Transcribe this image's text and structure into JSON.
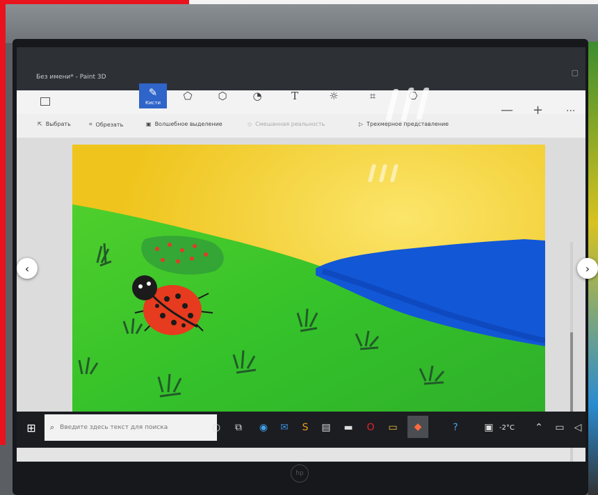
{
  "app": {
    "window_title": "Без имени* - Paint 3D"
  },
  "toolbar": {
    "tools": [
      {
        "name": "brushes",
        "label": "Кисти",
        "icon": "brush-icon",
        "active": true
      },
      {
        "name": "2d-shapes",
        "label": "",
        "icon": "shapes-2d-icon"
      },
      {
        "name": "3d-shapes",
        "label": "",
        "icon": "shapes-3d-icon"
      },
      {
        "name": "stickers",
        "label": "",
        "icon": "sticker-icon"
      },
      {
        "name": "text",
        "label": "",
        "icon": "text-icon"
      },
      {
        "name": "effects",
        "label": "",
        "icon": "effects-icon"
      },
      {
        "name": "canvas",
        "label": "",
        "icon": "crop-icon"
      },
      {
        "name": "3d-library",
        "label": "",
        "icon": "library-3d-icon"
      }
    ]
  },
  "subtoolbar": {
    "select_label": "Выбрать",
    "crop_label": "Обрезать",
    "magic_select_label": "Волшебное выделение",
    "mixed_reality_label": "Смешанная реальность",
    "view_3d_label": "Трехмерное представление"
  },
  "taskbar": {
    "search_placeholder": "Введите здесь текст для поиска",
    "temperature": "-2°C",
    "icons": [
      "windows-start-icon",
      "search-icon",
      "task-view-icon",
      "edge-icon",
      "mail-icon",
      "sublime-icon",
      "store-icon",
      "terminal-icon",
      "opera-icon",
      "file-explorer-icon",
      "paint3d-icon",
      "help-icon",
      "weather-icon",
      "chevron-up-icon",
      "network-icon",
      "volume-icon"
    ]
  },
  "colors": {
    "sky": "#f0c81f",
    "grass": "#37c12b",
    "river": "#1257d6",
    "ladybug": "#e63b1e",
    "accent": "#2f64c9"
  }
}
